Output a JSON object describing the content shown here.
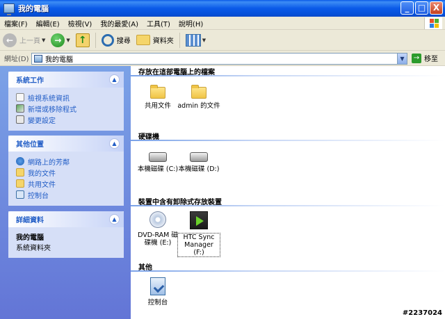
{
  "window": {
    "title": "我的電腦",
    "buttons": {
      "minimize": "_",
      "maximize": "□",
      "close": "X"
    }
  },
  "menu": [
    "檔案(F)",
    "編輯(E)",
    "檢視(V)",
    "我的最愛(A)",
    "工具(T)",
    "說明(H)"
  ],
  "toolbar": {
    "back_label": "上一頁",
    "search_label": "搜尋",
    "folders_label": "資料夾"
  },
  "address": {
    "label": "網址(D)",
    "value": "我的電腦",
    "go_label": "移至"
  },
  "left_pane": {
    "system_tasks": {
      "title": "系統工作",
      "links": [
        "檢視系統資訊",
        "新增或移除程式",
        "變更設定"
      ]
    },
    "other_places": {
      "title": "其他位置",
      "links": [
        "網路上的芳鄰",
        "我的文件",
        "共用文件",
        "控制台"
      ]
    },
    "details": {
      "title": "詳細資料",
      "name": "我的電腦",
      "type": "系統資料夾"
    }
  },
  "groups": {
    "files": {
      "title": "存放在這部電腦上的檔案",
      "items": [
        "共用文件",
        "admin 的文件"
      ]
    },
    "drives": {
      "title": "硬碟機",
      "items": [
        "本機磁碟 (C:)",
        "本機磁碟 (D:)"
      ]
    },
    "removable": {
      "title": "裝置中含有卸除式存放裝置",
      "items": [
        {
          "line1": "DVD-RAM 磁",
          "line2": "碟機 (E:)"
        },
        {
          "line1": "HTC Sync",
          "line2": "Manager (F:)"
        }
      ]
    },
    "other": {
      "title": "其他",
      "items": [
        "控制台"
      ]
    }
  },
  "watermark": "#2237024",
  "colors": {
    "titlebar": "#0a5ae8",
    "task_pane": "#7ba2e7",
    "link": "#215dc6"
  }
}
